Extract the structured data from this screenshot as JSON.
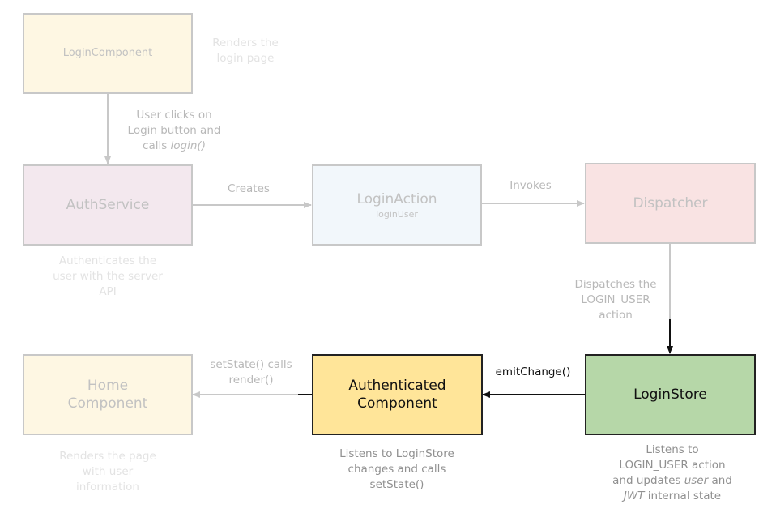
{
  "nodes": {
    "login_component": {
      "title": "LoginComponent",
      "desc": "Renders the login page",
      "fill": "#fef7e3"
    },
    "auth_service": {
      "title": "AuthService",
      "desc": "Authenticates the user with the server API",
      "fill": "#f3e8ee"
    },
    "login_action": {
      "title": "LoginAction",
      "subtitle": "loginUser",
      "fill": "#f2f7fb"
    },
    "dispatcher": {
      "title": "Dispatcher",
      "fill": "#f9e3e3"
    },
    "login_store": {
      "title": "LoginStore",
      "desc_line1": "Listens to",
      "desc_line2": "LOGIN_USER action",
      "desc_line3a": "and updates ",
      "desc_line3b": "user",
      "desc_line3c": " and",
      "desc_line4a": "JWT",
      "desc_line4b": " internal state",
      "fill": "#b6d7a8"
    },
    "authenticated_component": {
      "title_line1": "Authenticated",
      "title_line2": "Component",
      "desc": "Listens to LoginStore changes and calls setState()",
      "fill": "#ffe599"
    },
    "home_component": {
      "title_line1": "Home",
      "title_line2": "Component",
      "desc": "Renders the page with user information",
      "fill": "#fef7e3"
    }
  },
  "edges": {
    "login_to_auth": {
      "label_line1": "User clicks on",
      "label_line2": "Login button and",
      "label_line3a": "calls ",
      "label_line3b": "login()"
    },
    "auth_to_action": {
      "label": "Creates"
    },
    "action_to_dispatcher": {
      "label": "Invokes"
    },
    "dispatcher_to_store": {
      "label": "Dispatches the LOGIN_USER action"
    },
    "store_to_authenticated": {
      "label": "emitChange()"
    },
    "authenticated_to_home": {
      "label": "setState() calls render()"
    }
  },
  "colors": {
    "faded_line": "#c8c8c8",
    "active_line": "#111111"
  }
}
